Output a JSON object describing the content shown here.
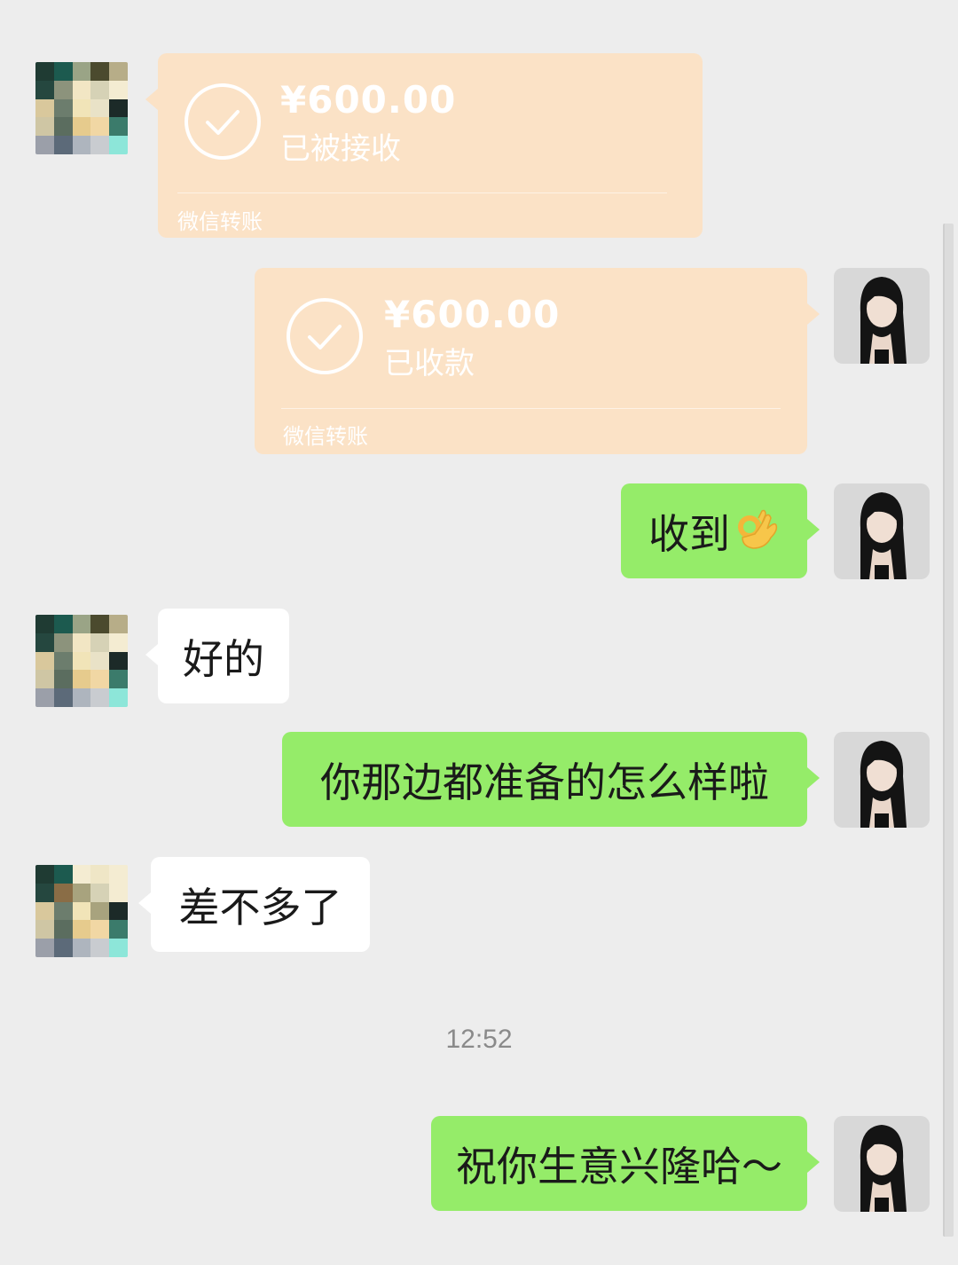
{
  "conversation": {
    "timestamp": "12:52",
    "messages": [
      {
        "side": "left",
        "kind": "transfer",
        "amount": "¥600.00",
        "status": "已被接收",
        "footer": "微信转账"
      },
      {
        "side": "right",
        "kind": "transfer",
        "amount": "¥600.00",
        "status": "已收款",
        "footer": "微信转账"
      },
      {
        "side": "right",
        "kind": "text",
        "text": "收到",
        "emoji": "ok-hand-emoji"
      },
      {
        "side": "left",
        "kind": "text",
        "text": "好的"
      },
      {
        "side": "right",
        "kind": "text",
        "text": "你那边都准备的怎么样啦"
      },
      {
        "side": "left",
        "kind": "text",
        "text": "差不多了"
      },
      {
        "side": "right",
        "kind": "text",
        "text": "祝你生意兴隆哈～"
      }
    ]
  },
  "colors": {
    "background": "#ededed",
    "green_bubble": "#95ec69",
    "white_bubble": "#ffffff",
    "transfer_bubble": "#fbe2c6"
  }
}
